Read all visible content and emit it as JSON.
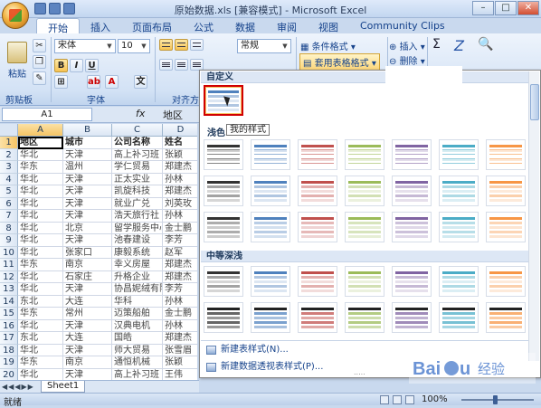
{
  "window": {
    "title": "原始数据.xls  [兼容模式]  -  Microsoft Excel",
    "min": "–",
    "max": "□",
    "close": "✕"
  },
  "tabs": [
    "开始",
    "插入",
    "页面布局",
    "公式",
    "数据",
    "审阅",
    "视图",
    "Community Clips"
  ],
  "ribbon": {
    "paste_label": "粘贴",
    "clipboard_group": "剪贴板",
    "font_name": "宋体",
    "font_size": "10",
    "font_group": "字体",
    "bold": "B",
    "italic": "I",
    "underline": "U",
    "align_group": "对齐方",
    "number_format": "常规",
    "cond_format": "条件格式",
    "table_format": "套用表格格式",
    "insert": "插入",
    "delete": "删除",
    "sigma": "Σ",
    "sort": "Z",
    "font_color_glyph": "A",
    "highlight_glyph": "ab"
  },
  "formula_bar": {
    "namebox": "A1",
    "fx": "fx",
    "value": "地区"
  },
  "columns": [
    "A",
    "B",
    "C",
    "D"
  ],
  "rows": [
    [
      "地区",
      "城市",
      "公司名称",
      "姓名"
    ],
    [
      "华北",
      "天津",
      "高上补习班",
      "张颖"
    ],
    [
      "华东",
      "温州",
      "学仁贸易",
      "郑建杰"
    ],
    [
      "华北",
      "天津",
      "正太实业",
      "孙林"
    ],
    [
      "华北",
      "天津",
      "凯旋科技",
      "郑建杰"
    ],
    [
      "华北",
      "天津",
      "就业广兑",
      "刘英玫"
    ],
    [
      "华北",
      "天津",
      "浩天旅行社",
      "孙林"
    ],
    [
      "华北",
      "北京",
      "留学服务中心",
      "金士鹏"
    ],
    [
      "华北",
      "天津",
      "池春建设",
      "李芳"
    ],
    [
      "华北",
      "张家口",
      "康毅系统",
      "赵军"
    ],
    [
      "华东",
      "南京",
      "幸义房屋",
      "郑建杰"
    ],
    [
      "华北",
      "石家庄",
      "升格企业",
      "郑建杰"
    ],
    [
      "华北",
      "天津",
      "协昌妮绒有限",
      "李芳"
    ],
    [
      "东北",
      "大连",
      "华科",
      "孙林"
    ],
    [
      "华东",
      "常州",
      "迈策船舶",
      "金士鹏"
    ],
    [
      "华北",
      "天津",
      "汉典电机",
      "孙林"
    ],
    [
      "东北",
      "大连",
      "国皓",
      "郑建杰"
    ],
    [
      "华北",
      "天津",
      "师大贸易",
      "张雪眉"
    ],
    [
      "华东",
      "南京",
      "通恒机械",
      "张颖"
    ],
    [
      "华北",
      "天津",
      "高上补习班",
      "王伟"
    ]
  ],
  "sheet_tab": "Sheet1",
  "status": {
    "ready": "就绪",
    "zoom": "100%"
  },
  "gallery": {
    "section_custom": "自定义",
    "section_light": "浅色",
    "section_medium": "中等深浅",
    "tooltip": "我的样式",
    "new_style": "新建表样式(N)...",
    "new_pivot_style": "新建数据透视表样式(P)...",
    "grip": "....."
  },
  "style_colors": [
    "#333333",
    "#4f81bd",
    "#c0504d",
    "#9bbb59",
    "#8064a2",
    "#4bacc6",
    "#f79646"
  ],
  "watermark": "Baidu 经验"
}
